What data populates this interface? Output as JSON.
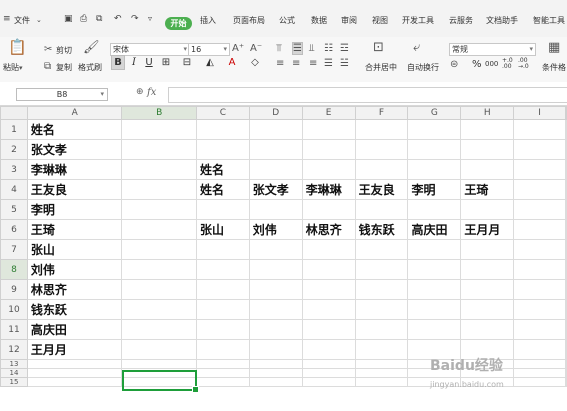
{
  "menu": {
    "file": "文件",
    "start": "开始",
    "items": [
      "插入",
      "页面布局",
      "公式",
      "数据",
      "审阅",
      "视图",
      "开发工具",
      "云服务",
      "文档助手",
      "智能工具"
    ]
  },
  "ribbon": {
    "paste": "粘贴",
    "cut": "剪切",
    "copy": "复制",
    "format_painter": "格式刷",
    "font_name": "宋体",
    "font_size": "16",
    "merge_center": "合并居中",
    "wrap_text": "自动换行",
    "number_format": "常规",
    "percent": "%",
    "thousands": "000",
    "cond_format": "条件格",
    "decimal_inc": "+.0 .00",
    "decimal_dec": ".00 →.0"
  },
  "formula_bar": {
    "name_box": "B8",
    "fx": "fx",
    "value": ""
  },
  "columns": [
    "A",
    "B",
    "C",
    "D",
    "E",
    "F",
    "G",
    "H",
    "I"
  ],
  "rows": [
    {
      "n": "1",
      "cells": [
        "姓名",
        "",
        "",
        "",
        "",
        "",
        "",
        "",
        ""
      ]
    },
    {
      "n": "2",
      "cells": [
        "张文孝",
        "",
        "",
        "",
        "",
        "",
        "",
        "",
        ""
      ]
    },
    {
      "n": "3",
      "cells": [
        "李琳琳",
        "",
        "姓名",
        "",
        "",
        "",
        "",
        "",
        ""
      ]
    },
    {
      "n": "4",
      "cells": [
        "王友良",
        "",
        "姓名",
        "张文孝",
        "李琳琳",
        "王友良",
        "李明",
        "王琦",
        ""
      ]
    },
    {
      "n": "5",
      "cells": [
        "李明",
        "",
        "",
        "",
        "",
        "",
        "",
        "",
        ""
      ]
    },
    {
      "n": "6",
      "cells": [
        "王琦",
        "",
        "张山",
        "刘伟",
        "林思齐",
        "钱东跃",
        "高庆田",
        "王月月",
        ""
      ]
    },
    {
      "n": "7",
      "cells": [
        "张山",
        "",
        "",
        "",
        "",
        "",
        "",
        "",
        ""
      ]
    },
    {
      "n": "8",
      "cells": [
        "刘伟",
        "",
        "",
        "",
        "",
        "",
        "",
        "",
        ""
      ]
    },
    {
      "n": "9",
      "cells": [
        "林思齐",
        "",
        "",
        "",
        "",
        "",
        "",
        "",
        ""
      ]
    },
    {
      "n": "10",
      "cells": [
        "钱东跃",
        "",
        "",
        "",
        "",
        "",
        "",
        "",
        ""
      ]
    },
    {
      "n": "11",
      "cells": [
        "高庆田",
        "",
        "",
        "",
        "",
        "",
        "",
        "",
        ""
      ]
    },
    {
      "n": "12",
      "cells": [
        "王月月",
        "",
        "",
        "",
        "",
        "",
        "",
        "",
        ""
      ]
    },
    {
      "n": "13",
      "cells": [
        "",
        "",
        "",
        "",
        "",
        "",
        "",
        "",
        ""
      ]
    },
    {
      "n": "14",
      "cells": [
        "",
        "",
        "",
        "",
        "",
        "",
        "",
        "",
        ""
      ]
    },
    {
      "n": "15",
      "cells": [
        "",
        "",
        "",
        "",
        "",
        "",
        "",
        "",
        ""
      ]
    }
  ],
  "selected_cell": "B8",
  "watermark": {
    "main": "Baidu经验",
    "sub": "jingyan.baidu.com"
  }
}
